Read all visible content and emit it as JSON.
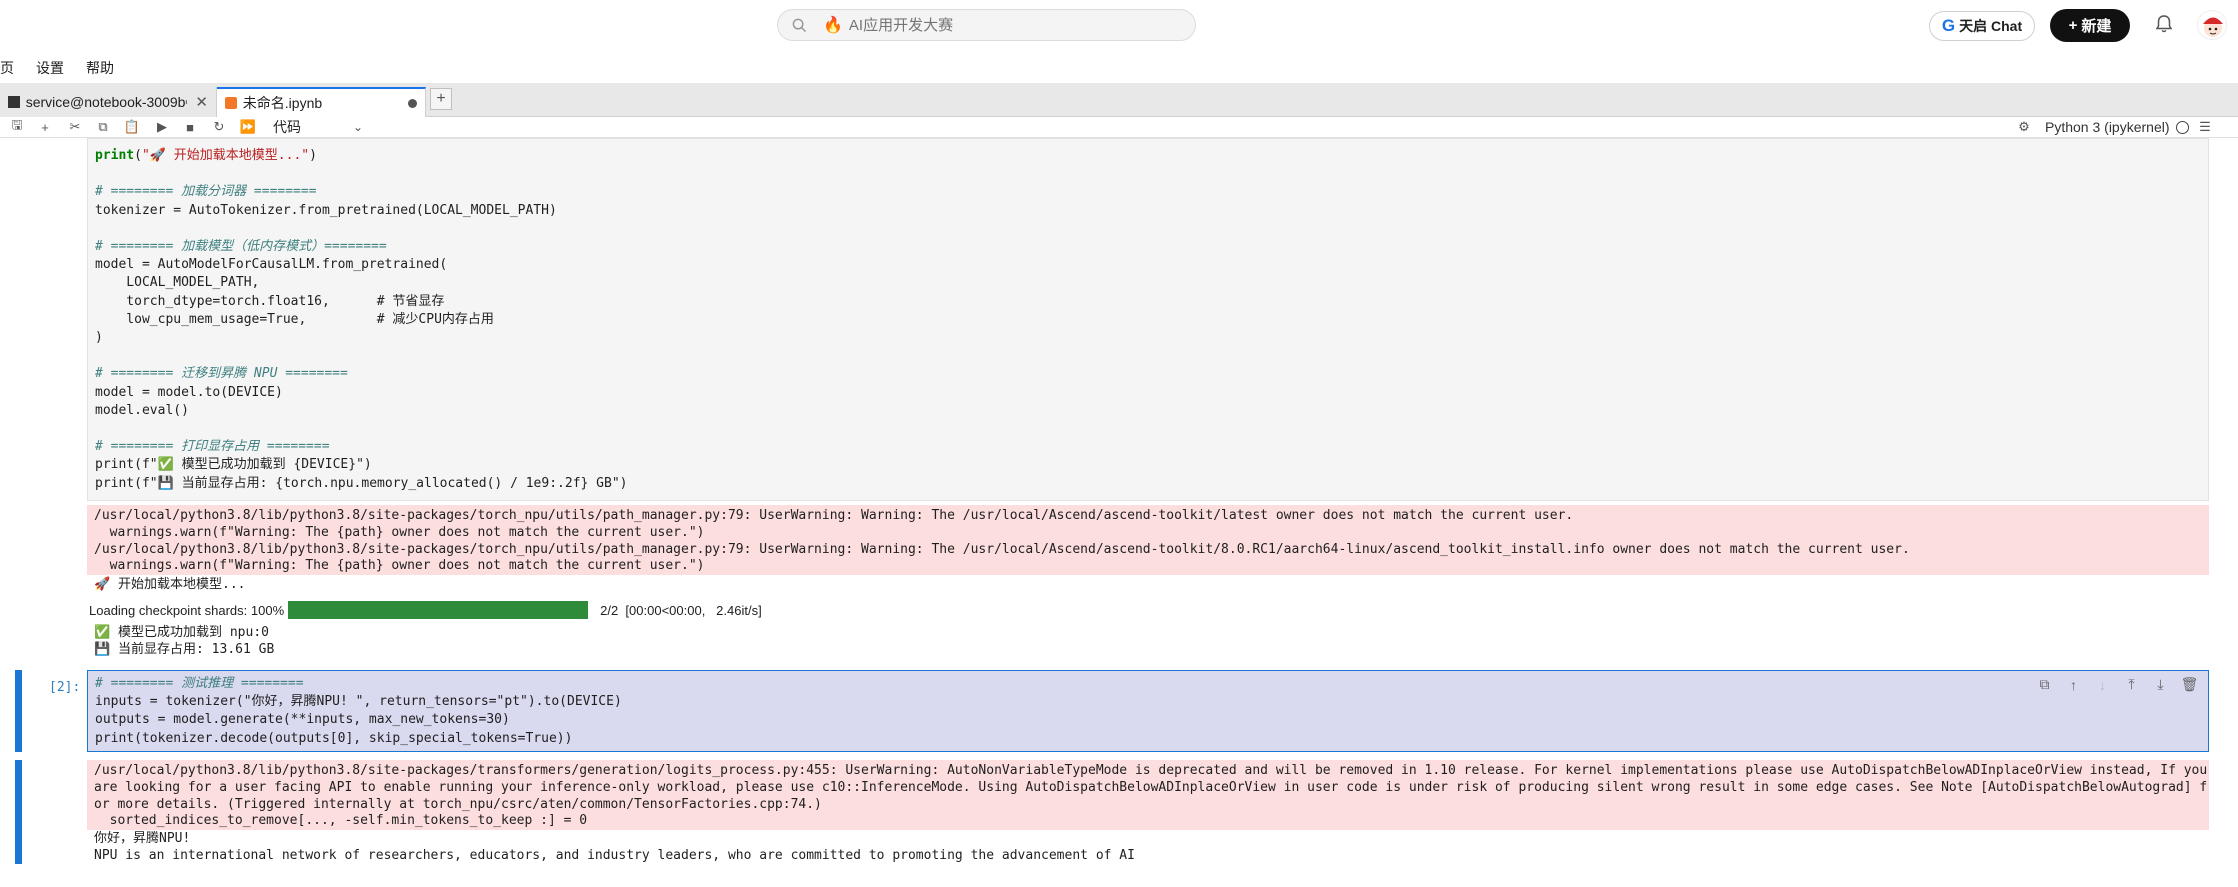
{
  "top": {
    "search_placeholder": "AI应用开发大赛",
    "chat_label": "天启 Chat",
    "new_label": "新建"
  },
  "menu": [
    "页",
    "设置",
    "帮助"
  ],
  "tabs": [
    {
      "label": "service@notebook-3009b€"
    },
    {
      "label": "未命名.ipynb"
    }
  ],
  "toolbar": {
    "cell_type": "代码",
    "kernel": "Python 3 (ipykernel)"
  },
  "cell1": {
    "lines": [
      "print(\"🚀 开始加载本地模型...\")",
      "",
      "# ======== 加载分词器 ========",
      "tokenizer = AutoTokenizer.from_pretrained(LOCAL_MODEL_PATH)",
      "",
      "# ======== 加载模型（低内存模式）========",
      "model = AutoModelForCausalLM.from_pretrained(",
      "    LOCAL_MODEL_PATH,",
      "    torch_dtype=torch.float16,      # 节省显存",
      "    low_cpu_mem_usage=True,         # 减少CPU内存占用",
      ")",
      "",
      "# ======== 迁移到昇腾 NPU ========",
      "model = model.to(DEVICE)",
      "model.eval()",
      "",
      "# ======== 打印显存占用 ========",
      "print(f\"✅ 模型已成功加载到 {DEVICE}\")",
      "print(f\"💾 当前显存占用: {torch.npu.memory_allocated() / 1e9:.2f} GB\")"
    ],
    "stderr": [
      "/usr/local/python3.8/lib/python3.8/site-packages/torch_npu/utils/path_manager.py:79: UserWarning: Warning: The /usr/local/Ascend/ascend-toolkit/latest owner does not match the current user.",
      "  warnings.warn(f\"Warning: The {path} owner does not match the current user.\")",
      "/usr/local/python3.8/lib/python3.8/site-packages/torch_npu/utils/path_manager.py:79: UserWarning: Warning: The /usr/local/Ascend/ascend-toolkit/8.0.RC1/aarch64-linux/ascend_toolkit_install.info owner does not match the current user.",
      "  warnings.warn(f\"Warning: The {path} owner does not match the current user.\")"
    ],
    "stdout1": "🚀 开始加载本地模型...",
    "progress": {
      "prefix": "Loading checkpoint shards: 100%",
      "fraction": 1.0,
      "suffix": "2/2  [00:00<00:00,   2.46it/s]"
    },
    "stdout2": [
      "✅ 模型已成功加载到 npu:0",
      "💾 当前显存占用: 13.61 GB"
    ]
  },
  "cell2": {
    "prompt": "[2]:",
    "lines": [
      "# ======== 测试推理 ========",
      "inputs = tokenizer(\"你好，昇腾NPU! \", return_tensors=\"pt\").to(DEVICE)",
      "outputs = model.generate(**inputs, max_new_tokens=30)",
      "print(tokenizer.decode(outputs[0], skip_special_tokens=True))"
    ],
    "stderr": [
      "/usr/local/python3.8/lib/python3.8/site-packages/transformers/generation/logits_process.py:455: UserWarning: AutoNonVariableTypeMode is deprecated and will be removed in 1.10 release. For kernel implementations please use AutoDispatchBelowADInplaceOrView instead, If you",
      "are looking for a user facing API to enable running your inference-only workload, please use c10::InferenceMode. Using AutoDispatchBelowADInplaceOrView in user code is under risk of producing silent wrong result in some edge cases. See Note [AutoDispatchBelowAutograd] f",
      "or more details. (Triggered internally at torch_npu/csrc/aten/common/TensorFactories.cpp:74.)",
      "  sorted_indices_to_remove[..., -self.min_tokens_to_keep :] = 0"
    ],
    "stdout": [
      "你好，昇腾NPU!",
      "NPU is an international network of researchers, educators, and industry leaders, who are committed to promoting the advancement of AI"
    ]
  }
}
